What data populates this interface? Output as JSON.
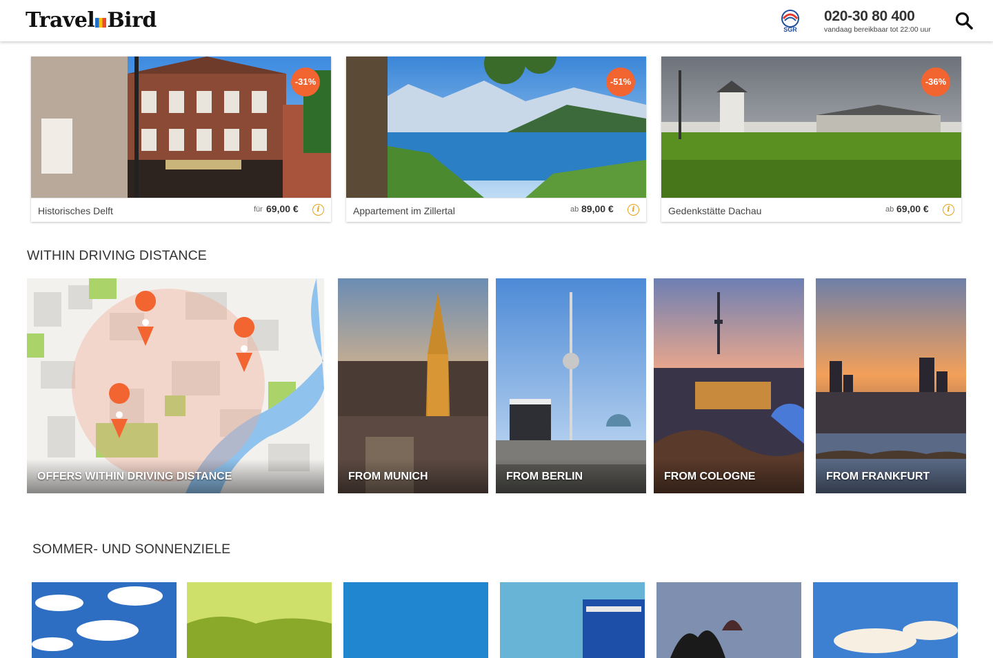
{
  "header": {
    "logo": "TravelBird",
    "logo_parts": [
      "Travel",
      "Bird"
    ],
    "phone": "020-30 80 400",
    "availability": "vandaag bereikbaar tot 22:00 uur",
    "sgr_label": "SGR"
  },
  "deals": [
    {
      "name": "Historisches Delft",
      "price_prefix": "für",
      "price": "69,00 €",
      "discount": "-31%"
    },
    {
      "name": "Appartement im Zillertal",
      "price_prefix": "ab",
      "price": "89,00 €",
      "discount": "-51%"
    },
    {
      "name": "Gedenkstätte Dachau",
      "price_prefix": "ab",
      "price": "69,00 €",
      "discount": "-36%"
    }
  ],
  "driving": {
    "title": "WITHIN DRIVING DISTANCE",
    "tiles": [
      {
        "label": "OFFERS WITHIN DRIVING DISTANCE"
      },
      {
        "label": "FROM MUNICH"
      },
      {
        "label": "FROM BERLIN"
      },
      {
        "label": "FROM COLOGNE"
      },
      {
        "label": "FROM FRANKFURT"
      }
    ]
  },
  "summer": {
    "title": "SOMMER- UND SONNENZIELE"
  },
  "colors": {
    "accent": "#f26430",
    "info": "#e6a217",
    "text": "#333333"
  }
}
